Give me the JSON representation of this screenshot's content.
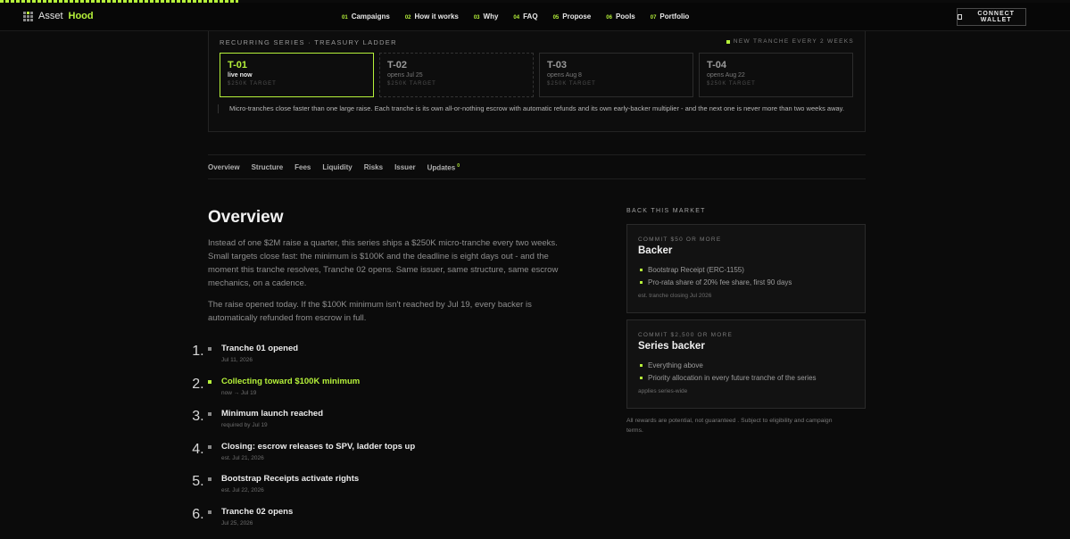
{
  "brand": {
    "name_a": "Asset",
    "name_b": "Hood"
  },
  "nav": [
    {
      "num": "01",
      "label": "Campaigns"
    },
    {
      "num": "02",
      "label": "How it works"
    },
    {
      "num": "03",
      "label": "Why"
    },
    {
      "num": "04",
      "label": "FAQ"
    },
    {
      "num": "05",
      "label": "Propose"
    },
    {
      "num": "06",
      "label": "Pools"
    },
    {
      "num": "07",
      "label": "Portfolio"
    }
  ],
  "connect_label": "CONNECT WALLET",
  "series": {
    "title": "RECURRING SERIES · TREASURY LADDER",
    "note": "NEW TRANCHE EVERY 2 WEEKS",
    "tranches": [
      {
        "id": "T-01",
        "status": "live now",
        "target": "$250K TARGET"
      },
      {
        "id": "T-02",
        "status": "opens Jul 25",
        "target": "$250K TARGET"
      },
      {
        "id": "T-03",
        "status": "opens Aug 8",
        "target": "$250K TARGET"
      },
      {
        "id": "T-04",
        "status": "opens Aug 22",
        "target": "$250K TARGET"
      }
    ],
    "description": "Micro-tranches close faster than one large raise. Each tranche is its own all-or-nothing escrow with automatic refunds and its own early-backer multiplier - and the next one is never more than two weeks away."
  },
  "tabs": [
    "Overview",
    "Structure",
    "Fees",
    "Liquidity",
    "Risks",
    "Issuer",
    "Updates"
  ],
  "tabs_updates_badge": "0",
  "overview": {
    "title": "Overview",
    "p1": "Instead of one $2M raise a quarter, this series ships a $250K micro-tranche every two weeks. Small targets close fast: the minimum is $100K and the deadline is eight days out - and the moment this tranche resolves, Tranche 02 opens. Same issuer, same structure, same escrow mechanics, on a cadence.",
    "p2": "The raise opened today. If the $100K minimum isn't reached by Jul 19, every backer is automatically refunded from escrow in full."
  },
  "timeline": [
    {
      "label": "Tranche 01 opened",
      "date": "Jul 11, 2026"
    },
    {
      "label": "Collecting toward $100K minimum",
      "date": "now → Jul 19"
    },
    {
      "label": "Minimum launch reached",
      "date": "required by Jul 19"
    },
    {
      "label": "Closing: escrow releases to SPV, ladder tops up",
      "date": "est. Jul 21, 2026"
    },
    {
      "label": "Bootstrap Receipts activate rights",
      "date": "est. Jul 22, 2026"
    },
    {
      "label": "Tranche 02 opens",
      "date": "Jul 25, 2026"
    }
  ],
  "back": {
    "title": "BACK THIS MARKET",
    "tiers": [
      {
        "commit": "COMMIT $50 OR MORE",
        "name": "Backer",
        "items": [
          "Bootstrap Receipt (ERC-1155)",
          "Pro-rata share of 20% fee share, first 90 days"
        ],
        "foot": "est. tranche closing Jul 2026"
      },
      {
        "commit": "COMMIT $2,500 OR MORE",
        "name": "Series backer",
        "items": [
          "Everything above",
          "Priority allocation in every future tranche of the series"
        ],
        "foot": "applies series-wide"
      }
    ],
    "disclaimer": "All rewards are potential, not guaranteed . Subject to eligibility and campaign terms."
  }
}
